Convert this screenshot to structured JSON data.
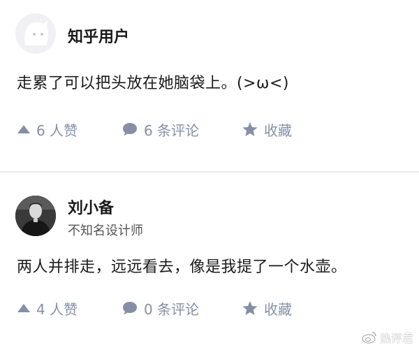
{
  "answers": [
    {
      "author": {
        "name": "知乎用户",
        "bio": ""
      },
      "content": "走累了可以把头放在她脑袋上。(>ω<)",
      "actions": {
        "vote_label": "6 人赞",
        "comment_label": "6 条评论",
        "favorite_label": "收藏"
      }
    },
    {
      "author": {
        "name": "刘小备",
        "bio": "不知名设计师"
      },
      "content": "两人并排走，远远看去，像是我提了一个水壶。",
      "actions": {
        "vote_label": "4 人赞",
        "comment_label": "0 条评论",
        "favorite_label": "收藏"
      }
    }
  ],
  "watermark": {
    "text": "热评君",
    "icon": "weibo-icon"
  },
  "colors": {
    "action_gray": "#8590a6",
    "divider": "#ebebeb",
    "text": "#1a1a1a"
  }
}
